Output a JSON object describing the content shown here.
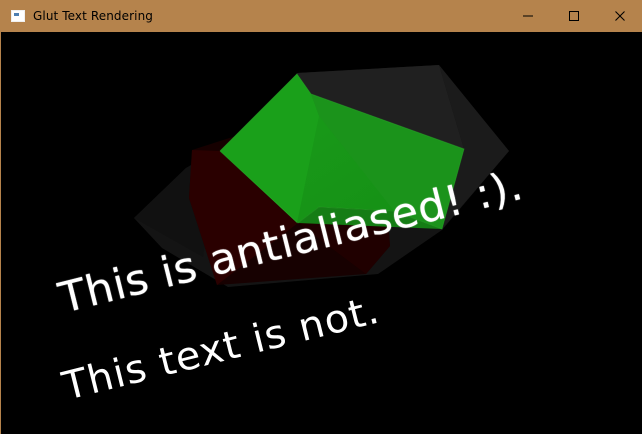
{
  "window": {
    "title": "Glut Text Rendering",
    "colors": {
      "title_bar": "#b5834c",
      "background": "#000000",
      "text": "#ffffff",
      "green_shape": "#20a020",
      "red_shape": "#4a0000",
      "gray_shape": "#2a2a2a"
    }
  },
  "controls": {
    "minimize_icon": "minimize-icon",
    "maximize_icon": "maximize-icon",
    "close_icon": "close-icon"
  },
  "scene": {
    "line_1": "This is antialiased! :).",
    "line_2": "This text is not."
  }
}
